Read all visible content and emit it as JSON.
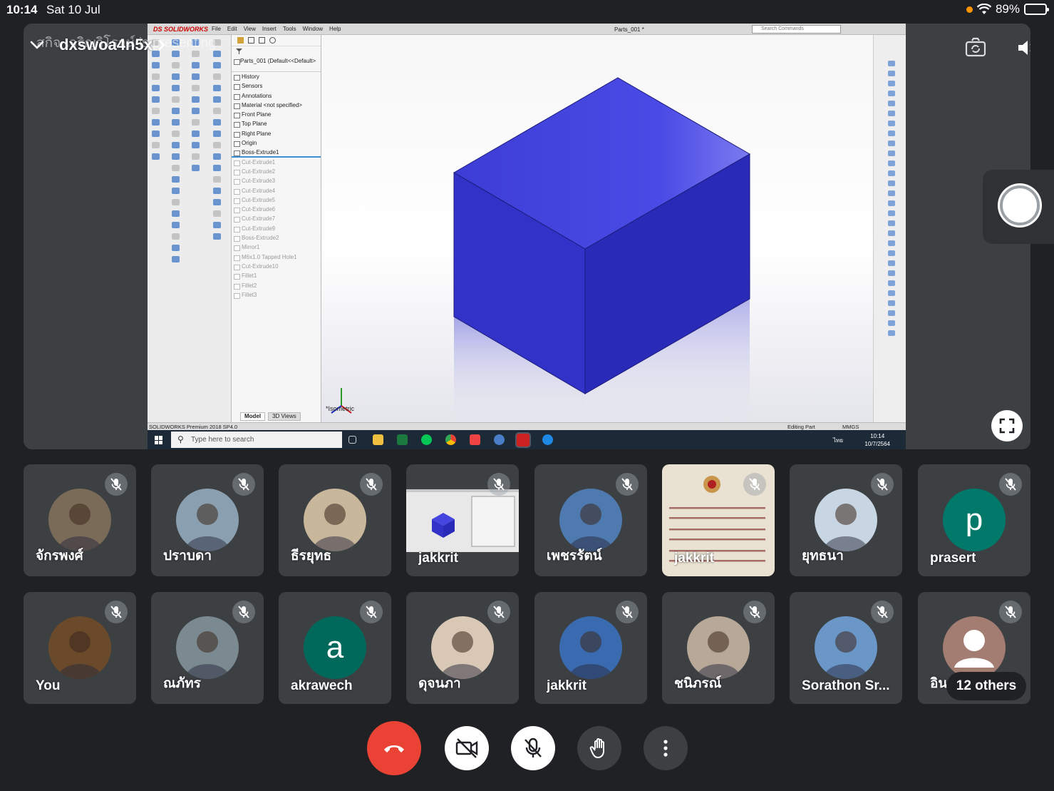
{
  "status_bar": {
    "time": "10:14",
    "date": "Sat 10 Jul",
    "battery_percent": "89%",
    "battery_level": 0.89
  },
  "presentation": {
    "meeting_code": "dxswoa4n5x",
    "presenter_overlay": "สกิจ เจริญวิโรจน์ is presenting"
  },
  "solidworks": {
    "logo": "DS SOLIDWORKS",
    "menu": [
      "File",
      "Edit",
      "View",
      "Insert",
      "Tools",
      "Window",
      "Help"
    ],
    "document_title": "Parts_001 *",
    "search_placeholder": "Search Commands",
    "tree_root": "Parts_001 (Default<<Default>",
    "tree_items": [
      {
        "label": "History",
        "dim": false
      },
      {
        "label": "Sensors",
        "dim": false
      },
      {
        "label": "Annotations",
        "dim": false
      },
      {
        "label": "Material <not specified>",
        "dim": false
      },
      {
        "label": "Front Plane",
        "dim": false
      },
      {
        "label": "Top Plane",
        "dim": false
      },
      {
        "label": "Right Plane",
        "dim": false
      },
      {
        "label": "Origin",
        "dim": false
      },
      {
        "label": "Boss-Extrude1",
        "dim": false
      },
      {
        "label": "Cut-Extrude1",
        "dim": true
      },
      {
        "label": "Cut-Extrude2",
        "dim": true
      },
      {
        "label": "Cut-Extrude3",
        "dim": true
      },
      {
        "label": "Cut-Extrude4",
        "dim": true
      },
      {
        "label": "Cut-Extrude5",
        "dim": true
      },
      {
        "label": "Cut-Extrude6",
        "dim": true
      },
      {
        "label": "Cut-Extrude7",
        "dim": true
      },
      {
        "label": "Cut-Extrude9",
        "dim": true
      },
      {
        "label": "Boss-Extrude2",
        "dim": true
      },
      {
        "label": "Mirror1",
        "dim": true
      },
      {
        "label": "M6x1.0 Tapped Hole1",
        "dim": true
      },
      {
        "label": "Cut-Extrude10",
        "dim": true
      },
      {
        "label": "Fillet1",
        "dim": true
      },
      {
        "label": "Fillet2",
        "dim": true
      },
      {
        "label": "Fillet3",
        "dim": true
      }
    ],
    "view_label": "*Isometric",
    "tabs": [
      "Model",
      "3D Views"
    ],
    "status_left": "SOLIDWORKS Premium 2018 SP4.0",
    "status_editing": "Editing Part",
    "status_units": "MMGS",
    "taskbar_search": "Type here to search",
    "taskbar_lang": "ไทย",
    "taskbar_time": "10:14",
    "taskbar_date": "10/7/2564",
    "cube_colors": {
      "top": "#4545e0",
      "left": "#3232c8",
      "right": "#2a2ab8"
    }
  },
  "participants": [
    {
      "name": "จักรพงศ์",
      "kind": "photo",
      "bg": "#7a6a58"
    },
    {
      "name": "ปราบดา",
      "kind": "photo",
      "bg": "#8aa0b0"
    },
    {
      "name": "ธีรยุทธ",
      "kind": "photo",
      "bg": "#c9b79c"
    },
    {
      "name": "jakkrit",
      "kind": "screen",
      "bg": "#1d2733"
    },
    {
      "name": "เพชรรัตน์",
      "kind": "photo",
      "bg": "#4f7ab0"
    },
    {
      "name": "jakkrit",
      "kind": "certificate",
      "bg": "#e9e2d2"
    },
    {
      "name": "ยุทธนา",
      "kind": "photo",
      "bg": "#c8d6e3"
    },
    {
      "name": "prasert",
      "kind": "letter",
      "letter": "p",
      "bg": "#00796b"
    },
    {
      "name": "You",
      "kind": "photo",
      "bg": "#6a4a2a"
    },
    {
      "name": "ณภัทร",
      "kind": "photo",
      "bg": "#7a8a90"
    },
    {
      "name": "akrawech",
      "kind": "letter",
      "letter": "a",
      "bg": "#00695c"
    },
    {
      "name": "ดุจนภา",
      "kind": "photo",
      "bg": "#d9c8b5"
    },
    {
      "name": "jakkrit",
      "kind": "photo",
      "bg": "#3a6ab0"
    },
    {
      "name": "ชนิภรณ์",
      "kind": "photo",
      "bg": "#b7a898"
    },
    {
      "name": "Sorathon Sr...",
      "kind": "photo",
      "bg": "#6a96c8"
    },
    {
      "name": "อิน",
      "kind": "default",
      "bg": "#e8c8c0"
    }
  ],
  "others_label": "12 others",
  "colors": {
    "background": "#202124",
    "tile": "#3c4043",
    "end_call": "#ea4335",
    "avatar_teal": "#00796b"
  }
}
